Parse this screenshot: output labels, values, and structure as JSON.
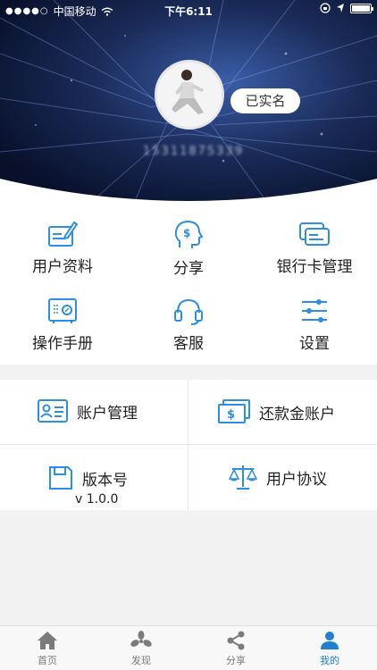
{
  "status_bar": {
    "signal": "●●●●○",
    "carrier": "中国移动",
    "time": "下午6:11"
  },
  "profile": {
    "verified_label": "已实名",
    "phone": "15311875339"
  },
  "menu": [
    {
      "label": "用户资料",
      "icon": "user-info-icon"
    },
    {
      "label": "分享",
      "icon": "share-head-icon"
    },
    {
      "label": "银行卡管理",
      "icon": "bank-card-icon"
    },
    {
      "label": "操作手册",
      "icon": "manual-safe-icon"
    },
    {
      "label": "客服",
      "icon": "headset-icon"
    },
    {
      "label": "设置",
      "icon": "settings-sliders-icon"
    }
  ],
  "cards": {
    "account": {
      "label": "账户管理",
      "icon": "id-card-icon"
    },
    "repayment": {
      "label": "还款金账户",
      "icon": "money-icon"
    },
    "version": {
      "label": "版本号",
      "value": "v 1.0.0",
      "icon": "save-icon"
    },
    "agreement": {
      "label": "用户协议",
      "icon": "scale-icon"
    }
  },
  "tabs": [
    {
      "label": "首页",
      "icon": "home-icon"
    },
    {
      "label": "发现",
      "icon": "discover-icon"
    },
    {
      "label": "分享",
      "icon": "share-icon"
    },
    {
      "label": "我的",
      "icon": "profile-icon",
      "active": true
    }
  ],
  "colors": {
    "accent": "#1f7fd1",
    "icon_blue": "#2c8fe0",
    "header_bg": "#0d1734"
  }
}
